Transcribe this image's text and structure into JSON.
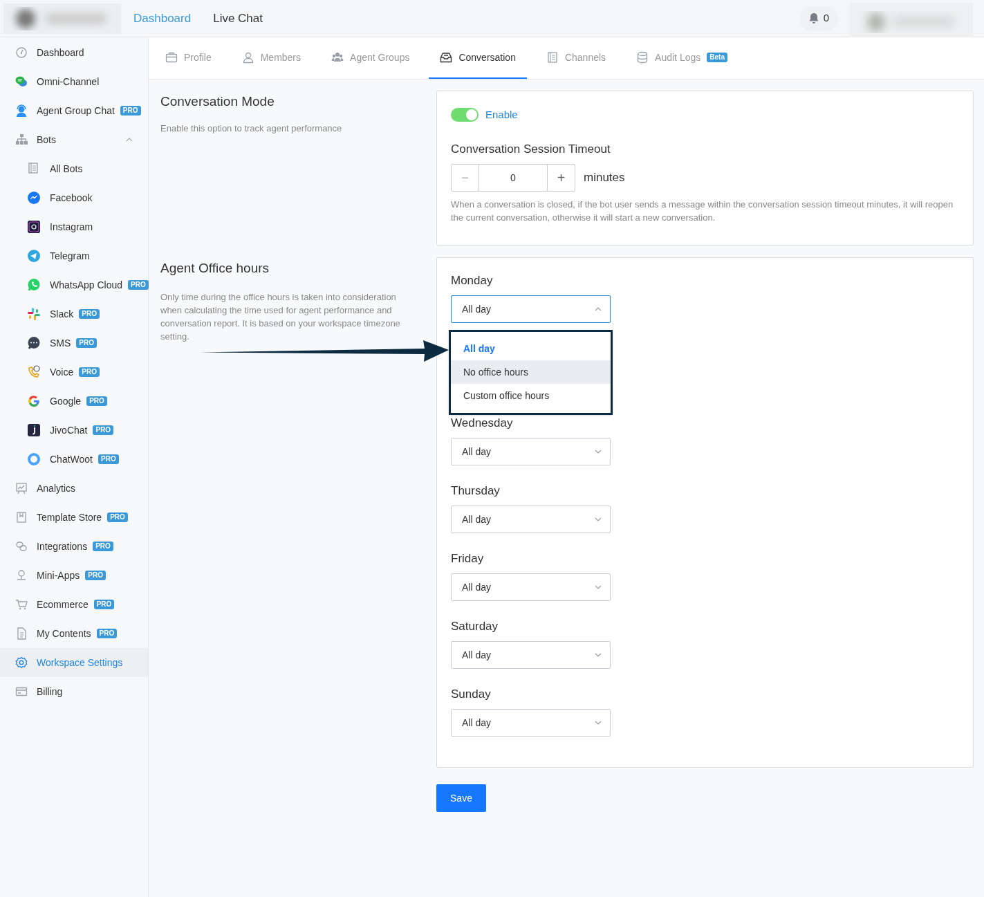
{
  "header": {
    "nav": [
      {
        "label": "Dashboard",
        "selected": true
      },
      {
        "label": "Live Chat",
        "selected": false
      }
    ],
    "notifications": {
      "count": "0"
    }
  },
  "sidebar": {
    "items": [
      {
        "label": "Dashboard",
        "selected": false
      },
      {
        "label": "Omni-Channel",
        "selected": false
      },
      {
        "label": "Agent Group Chat",
        "badge": "PRO",
        "selected": false
      },
      {
        "label": "Bots",
        "selected": false,
        "expanded": true,
        "children": [
          {
            "label": "All Bots",
            "selected": false
          },
          {
            "label": "Facebook",
            "selected": false
          },
          {
            "label": "Instagram",
            "selected": false
          },
          {
            "label": "Telegram",
            "selected": false
          },
          {
            "label": "WhatsApp Cloud",
            "badge": "PRO",
            "selected": false
          },
          {
            "label": "Slack",
            "badge": "PRO",
            "selected": false
          },
          {
            "label": "SMS",
            "badge": "PRO",
            "selected": false
          },
          {
            "label": "Voice",
            "badge": "PRO",
            "selected": false
          },
          {
            "label": "Google",
            "badge": "PRO",
            "selected": false
          },
          {
            "label": "JivoChat",
            "badge": "PRO",
            "selected": false
          },
          {
            "label": "ChatWoot",
            "badge": "PRO",
            "selected": false
          }
        ]
      },
      {
        "label": "Analytics",
        "selected": false
      },
      {
        "label": "Template Store",
        "badge": "PRO",
        "selected": false
      },
      {
        "label": "Integrations",
        "badge": "PRO",
        "selected": false
      },
      {
        "label": "Mini-Apps",
        "badge": "PRO",
        "selected": false
      },
      {
        "label": "Ecommerce",
        "badge": "PRO",
        "selected": false
      },
      {
        "label": "My Contents",
        "badge": "PRO",
        "selected": false
      },
      {
        "label": "Workspace Settings",
        "selected": true
      },
      {
        "label": "Billing",
        "selected": false
      }
    ]
  },
  "tabs": [
    {
      "label": "Profile",
      "selected": false
    },
    {
      "label": "Members",
      "selected": false
    },
    {
      "label": "Agent Groups",
      "selected": false
    },
    {
      "label": "Conversation",
      "selected": true
    },
    {
      "label": "Channels",
      "selected": false
    },
    {
      "label": "Audit Logs",
      "badge": "Beta",
      "selected": false
    }
  ],
  "conversation_mode": {
    "title": "Conversation Mode",
    "description": "Enable this option to track agent performance",
    "enabled": true,
    "toggle_label": "Enable",
    "timeout_label": "Conversation Session Timeout",
    "timeout_value": "0",
    "minus": "−",
    "plus": "+",
    "unit": "minutes",
    "help": "When a conversation is closed, if the bot user sends a message within the conversation session timeout minutes, it will reopen the current conversation, otherwise it will start a new conversation."
  },
  "office_hours": {
    "title": "Agent Office hours",
    "description": "Only time during the office hours is taken into consideration when calculating the time used for agent performance and conversation report. It is based on your workspace timezone setting.",
    "days": [
      {
        "label": "Monday",
        "value": "All day",
        "expanded": true,
        "options": [
          {
            "label": "All day",
            "selected": true,
            "highlighted": false
          },
          {
            "label": "No office hours",
            "selected": false,
            "highlighted": true
          },
          {
            "label": "Custom office hours",
            "selected": false,
            "highlighted": false
          }
        ]
      },
      {
        "label": "Wednesday",
        "value": "All day",
        "expanded": false
      },
      {
        "label": "Thursday",
        "value": "All day",
        "expanded": false
      },
      {
        "label": "Friday",
        "value": "All day",
        "expanded": false
      },
      {
        "label": "Saturday",
        "value": "All day",
        "expanded": false
      },
      {
        "label": "Sunday",
        "value": "All day",
        "expanded": false
      }
    ]
  },
  "save_button": "Save"
}
